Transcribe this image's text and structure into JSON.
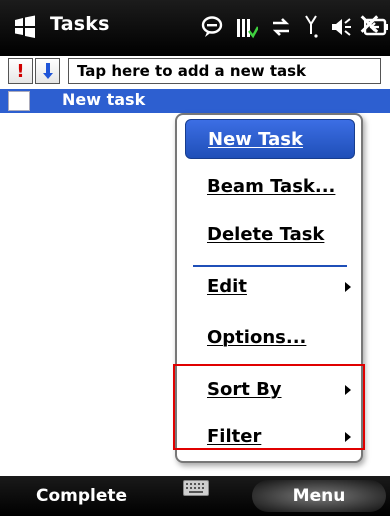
{
  "titlebar": {
    "app_title": "Tasks",
    "icons": [
      "windows-start-icon",
      "notification-icon",
      "signal-strength-icon",
      "data-connection-icon",
      "antenna-icon",
      "volume-icon",
      "battery-icon"
    ],
    "close_glyph": "✕"
  },
  "entry": {
    "priority_high_glyph": "!",
    "priority_low_glyph": "↓",
    "placeholder": "Tap here to add a new task"
  },
  "tasks": [
    {
      "title": "New task",
      "checked": false,
      "selected": true
    }
  ],
  "menu": {
    "items": [
      {
        "label": "New Task",
        "selected": true,
        "submenu": false
      },
      {
        "label": "Beam Task...",
        "selected": false,
        "submenu": false
      },
      {
        "label": "Delete Task",
        "selected": false,
        "submenu": false
      },
      {
        "label": "Edit",
        "selected": false,
        "submenu": true
      },
      {
        "label": "Options...",
        "selected": false,
        "submenu": false
      },
      {
        "label": "Sort By",
        "selected": false,
        "submenu": true
      },
      {
        "label": "Filter",
        "selected": false,
        "submenu": true
      }
    ]
  },
  "softkeys": {
    "left": "Complete",
    "right": "Menu"
  },
  "colors": {
    "selection": "#2d5fd0",
    "highlight_box": "#e00000",
    "priority_high": "#d00000"
  }
}
